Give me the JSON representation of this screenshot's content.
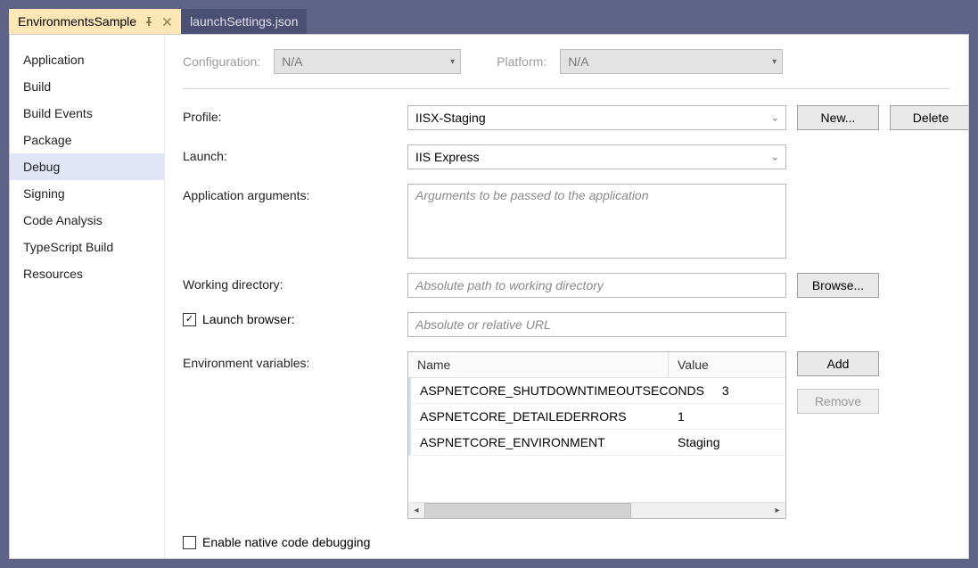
{
  "tabs": [
    {
      "title": "EnvironmentsSample",
      "active": true
    },
    {
      "title": "launchSettings.json",
      "active": false
    }
  ],
  "sidebar": {
    "items": [
      "Application",
      "Build",
      "Build Events",
      "Package",
      "Debug",
      "Signing",
      "Code Analysis",
      "TypeScript Build",
      "Resources"
    ],
    "selected_index": 4
  },
  "topbar": {
    "configuration_label": "Configuration:",
    "configuration_value": "N/A",
    "platform_label": "Platform:",
    "platform_value": "N/A"
  },
  "form": {
    "profile_label": "Profile:",
    "profile_value": "IISX-Staging",
    "new_button": "New...",
    "delete_button": "Delete",
    "launch_label": "Launch:",
    "launch_value": "IIS Express",
    "app_args_label": "Application arguments:",
    "app_args_placeholder": "Arguments to be passed to the application",
    "app_args_value": "",
    "workdir_label": "Working directory:",
    "workdir_placeholder": "Absolute path to working directory",
    "workdir_value": "",
    "browse_button": "Browse...",
    "launch_browser_label": "Launch browser:",
    "launch_browser_checked": true,
    "launch_browser_url_placeholder": "Absolute or relative URL",
    "launch_browser_url_value": "",
    "envvars_label": "Environment variables:",
    "envvars_header_name": "Name",
    "envvars_header_value": "Value",
    "envvars": [
      {
        "name": "ASPNETCORE_SHUTDOWNTIMEOUTSECONDS",
        "value": "3"
      },
      {
        "name": "ASPNETCORE_DETAILEDERRORS",
        "value": "1"
      },
      {
        "name": "ASPNETCORE_ENVIRONMENT",
        "value": "Staging"
      }
    ],
    "add_button": "Add",
    "remove_button": "Remove",
    "native_debug_label": "Enable native code debugging",
    "native_debug_checked": false
  }
}
